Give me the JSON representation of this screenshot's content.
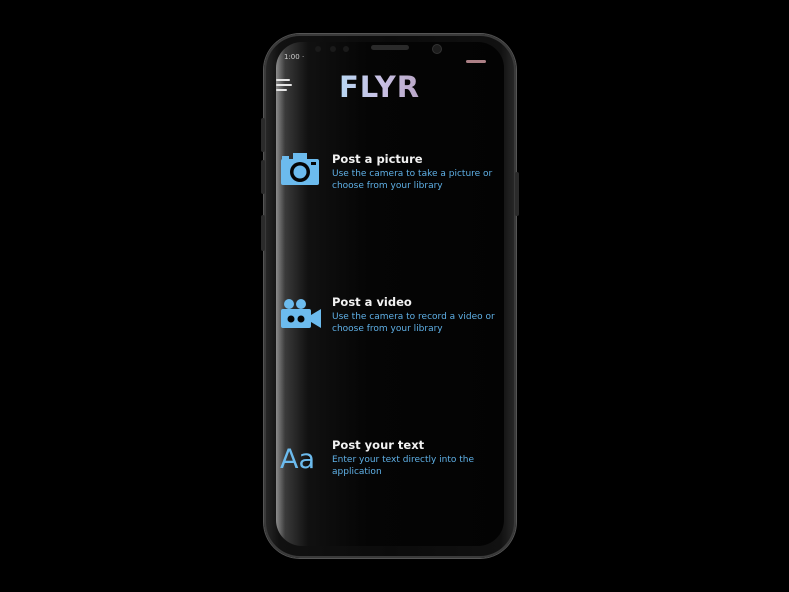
{
  "status": {
    "time": "1:00 ·"
  },
  "app": {
    "logo_text": "FLYR"
  },
  "options": [
    {
      "title": "Post a picture",
      "description": "Use the camera to take a picture or choose from your library",
      "icon": "camera-icon"
    },
    {
      "title": "Post a video",
      "description": "Use the camera to record a video or choose from your library",
      "icon": "video-camera-icon"
    },
    {
      "title": "Post your text",
      "description": "Enter your text directly into the application",
      "icon": "text-aa-icon",
      "icon_text": "Aa"
    }
  ],
  "colors": {
    "accent": "#6cbbee",
    "background": "#000000",
    "title": "#f2f2f2"
  }
}
